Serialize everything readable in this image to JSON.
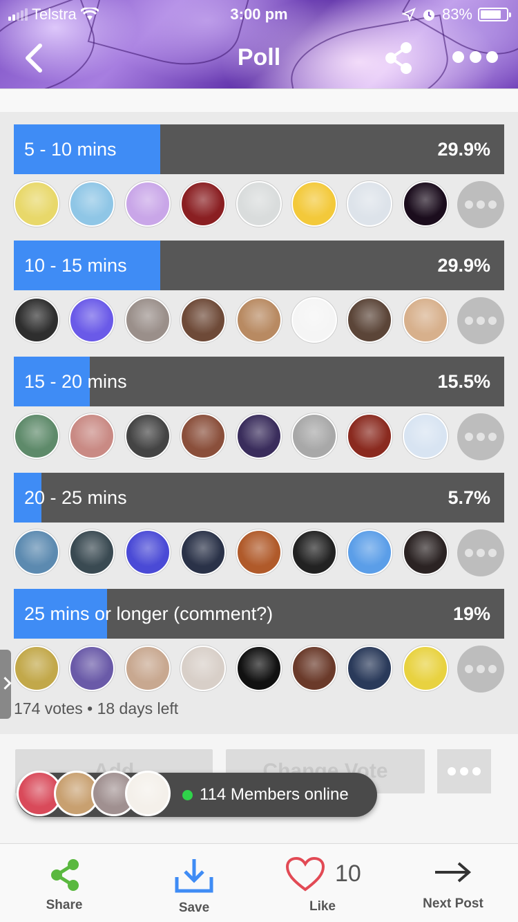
{
  "status_bar": {
    "carrier": "Telstra",
    "time": "3:00 pm",
    "battery": "83%"
  },
  "nav": {
    "title": "Poll",
    "back_icon": "chevron-left-icon",
    "share_icon": "share-icon",
    "more_icon": "more-dots-icon"
  },
  "poll": {
    "options": [
      {
        "label": "5 - 10 mins",
        "percent_text": "29.9%",
        "percent": 29.9,
        "avatars": [
          "#e8d86a",
          "#8fc6e6",
          "#c9a6e8",
          "#8a1f22",
          "#d9dcdc",
          "#f3c93a",
          "#dde3ea",
          "#1b0d1d"
        ]
      },
      {
        "label": "10 - 15 mins",
        "percent_text": "29.9%",
        "percent": 29.9,
        "avatars": [
          "#2e2e2e",
          "#6a5ae8",
          "#9a8f8a",
          "#6e4a38",
          "#b88a62",
          "#f5f5f5",
          "#5b4538",
          "#d7b08c"
        ]
      },
      {
        "label": "15 - 20 mins",
        "percent_text": "15.5%",
        "percent": 15.5,
        "avatars": [
          "#5e8a6a",
          "#c98a84",
          "#444444",
          "#8a4f3b",
          "#3a2d5c",
          "#a8a8a8",
          "#8a2a1f",
          "#d8e4f2"
        ]
      },
      {
        "label": "20 - 25 mins",
        "percent_text": "5.7%",
        "percent": 5.7,
        "avatars": [
          "#5c8ab0",
          "#3a4a52",
          "#4a4ad6",
          "#2a3248",
          "#b05a2a",
          "#222222",
          "#5b9ee8",
          "#2b2323"
        ]
      },
      {
        "label": "25 mins or longer (comment?)",
        "percent_text": "19%",
        "percent": 19,
        "avatars": [
          "#c2a84a",
          "#6a5aa8",
          "#c8a890",
          "#d8cfc8",
          "#111111",
          "#6a3a2a",
          "#2a3a5a",
          "#e8d240"
        ]
      }
    ],
    "meta": "174 votes • 18 days left"
  },
  "actions": {
    "add_label": "Add",
    "change_vote_label": "Change Vote"
  },
  "online": {
    "text": "114 Members online",
    "avatars": [
      "#d94a5a",
      "#c8a070",
      "#a09090",
      "#f4f0ea"
    ]
  },
  "bottom_bar": {
    "share": "Share",
    "save": "Save",
    "like": "Like",
    "like_count": "10",
    "next_post": "Next Post"
  },
  "colors": {
    "accent": "#3f8cf5",
    "bar_track": "#575757",
    "share_green": "#5ab83f",
    "save_blue": "#3f8cf5",
    "like_red": "#e24a55"
  }
}
